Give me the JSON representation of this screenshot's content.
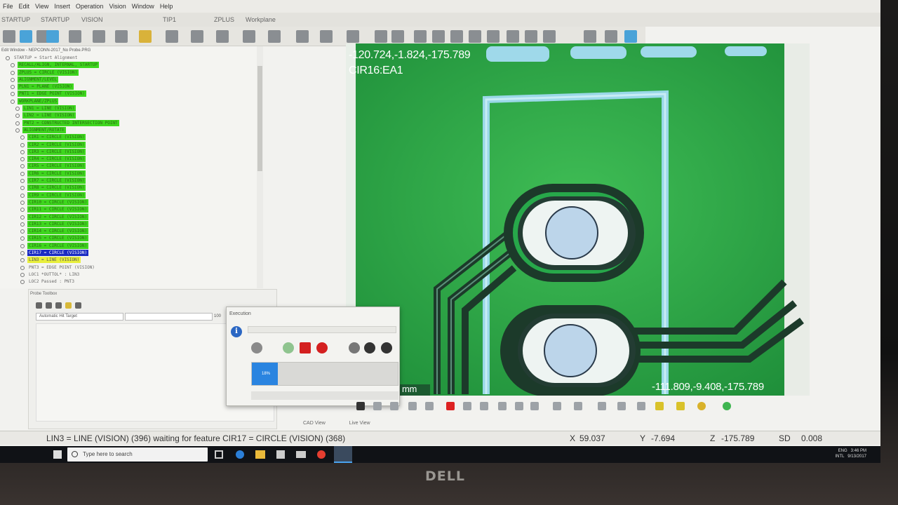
{
  "menu": [
    "File",
    "Edit",
    "View",
    "Insert",
    "Operation",
    "Vision",
    "Window",
    "Help"
  ],
  "tabs": [
    "STARTUP",
    "STARTUP",
    "VISION",
    "TIP1",
    "ZPLUS",
    "Workplane"
  ],
  "edit_window": {
    "title": "Edit Window - NEPCONN-2017_No Probe.PRG",
    "items": [
      {
        "text": "STARTUP = Start Alignment",
        "style": "normal",
        "indent": 0
      },
      {
        "text": "RECALL/ALIGN, INTERNAL, STARTUP",
        "style": "hl",
        "indent": 1
      },
      {
        "text": "ZPLUS = CIRCLE (VISION)",
        "style": "hl",
        "indent": 1
      },
      {
        "text": "ALIGNMENT/LEVEL",
        "style": "hl",
        "indent": 1
      },
      {
        "text": "PLN1 = PLANE (VISION)",
        "style": "hl",
        "indent": 1
      },
      {
        "text": "PNT1 = EDGE POINT (VISION)",
        "style": "hl",
        "indent": 1
      },
      {
        "text": "WORKPLANE/ZPLUS",
        "style": "hl",
        "indent": 1
      },
      {
        "text": "LIN1 = LINE (VISION)",
        "style": "hl",
        "indent": 2
      },
      {
        "text": "LIN2 = LINE (VISION)",
        "style": "hl",
        "indent": 2
      },
      {
        "text": "PNT2 = CONSTRUCTED INTERSECTION POINT",
        "style": "hl",
        "indent": 2
      },
      {
        "text": "ALIGNMENT/ROTATE",
        "style": "hl",
        "indent": 2
      },
      {
        "text": "CIR1 = CIRCLE (VISION)",
        "style": "hl",
        "indent": 3
      },
      {
        "text": "CIR2 = CIRCLE (VISION)",
        "style": "hl",
        "indent": 3
      },
      {
        "text": "CIR3 = CIRCLE (VISION)",
        "style": "hl",
        "indent": 3
      },
      {
        "text": "CIR4 = CIRCLE (VISION)",
        "style": "hl",
        "indent": 3
      },
      {
        "text": "CIR5 = CIRCLE (VISION)",
        "style": "hl",
        "indent": 3
      },
      {
        "text": "CIR6 = CIRCLE (VISION)",
        "style": "hl",
        "indent": 3
      },
      {
        "text": "CIR7 = CIRCLE (VISION)",
        "style": "hl",
        "indent": 3
      },
      {
        "text": "CIR8 = CIRCLE (VISION)",
        "style": "hl",
        "indent": 3
      },
      {
        "text": "CIR9 = CIRCLE (VISION)",
        "style": "hl",
        "indent": 3
      },
      {
        "text": "CIR10 = CIRCLE (VISION)",
        "style": "hl",
        "indent": 3
      },
      {
        "text": "CIR11 = CIRCLE (VISION)",
        "style": "hl",
        "indent": 3
      },
      {
        "text": "CIR12 = CIRCLE (VISION)",
        "style": "hl",
        "indent": 3
      },
      {
        "text": "CIR13 = CIRCLE (VISION)",
        "style": "hl",
        "indent": 3
      },
      {
        "text": "CIR14 = CIRCLE (VISION)",
        "style": "hl",
        "indent": 3
      },
      {
        "text": "CIR15 = CIRCLE (VISION)",
        "style": "hl",
        "indent": 3
      },
      {
        "text": "CIR16 = CIRCLE (VISION)",
        "style": "hl",
        "indent": 3
      },
      {
        "text": "CIR17 = CIRCLE (VISION)",
        "style": "sel",
        "indent": 3
      },
      {
        "text": "LIN3 = LINE (VISION)",
        "style": "yel",
        "indent": 3
      },
      {
        "text": "PNT3 = EDGE POINT (VISION)",
        "style": "normal",
        "indent": 3
      },
      {
        "text": "LOC1 *OUTTOL* : LIN3",
        "style": "normal",
        "indent": 3
      },
      {
        "text": "LOC2 Passed : PNT3",
        "style": "normal",
        "indent": 3
      }
    ]
  },
  "probe_toolbox": {
    "title": "Probe Toolbox",
    "hit_target": "Automatic Hit Target",
    "value": "100"
  },
  "execution": {
    "title": "Execution",
    "progress": 0.18,
    "progress_label": "18%"
  },
  "camera": {
    "coords_top": "-120.724,-1.824,-175.789",
    "feature_label": "CIR16:EA1",
    "coords_bottom": "-111.809,-9.408,-175.789",
    "unit": "mm"
  },
  "view_tabs": [
    "CAD View",
    "Live View"
  ],
  "status": {
    "message": "LIN3 = LINE (VISION) (396) waiting for feature CIR17 = CIRCLE (VISION) (368)",
    "x_label": "X",
    "x": "59.037",
    "y_label": "Y",
    "y": "-7.694",
    "z_label": "Z",
    "z": "-175.789",
    "sd_label": "SD",
    "sd": "0.008"
  },
  "taskbar": {
    "search_placeholder": "Type here to search",
    "lang": "ENG",
    "lang2": "INTL",
    "time": "3:46 PM",
    "date": "9/13/2017"
  },
  "monitor_brand": "DELL",
  "colors": {
    "highlight": "#3ed61e",
    "selected": "#1a2bc2",
    "progress": "#2a84e0",
    "board": "#2fae48"
  }
}
